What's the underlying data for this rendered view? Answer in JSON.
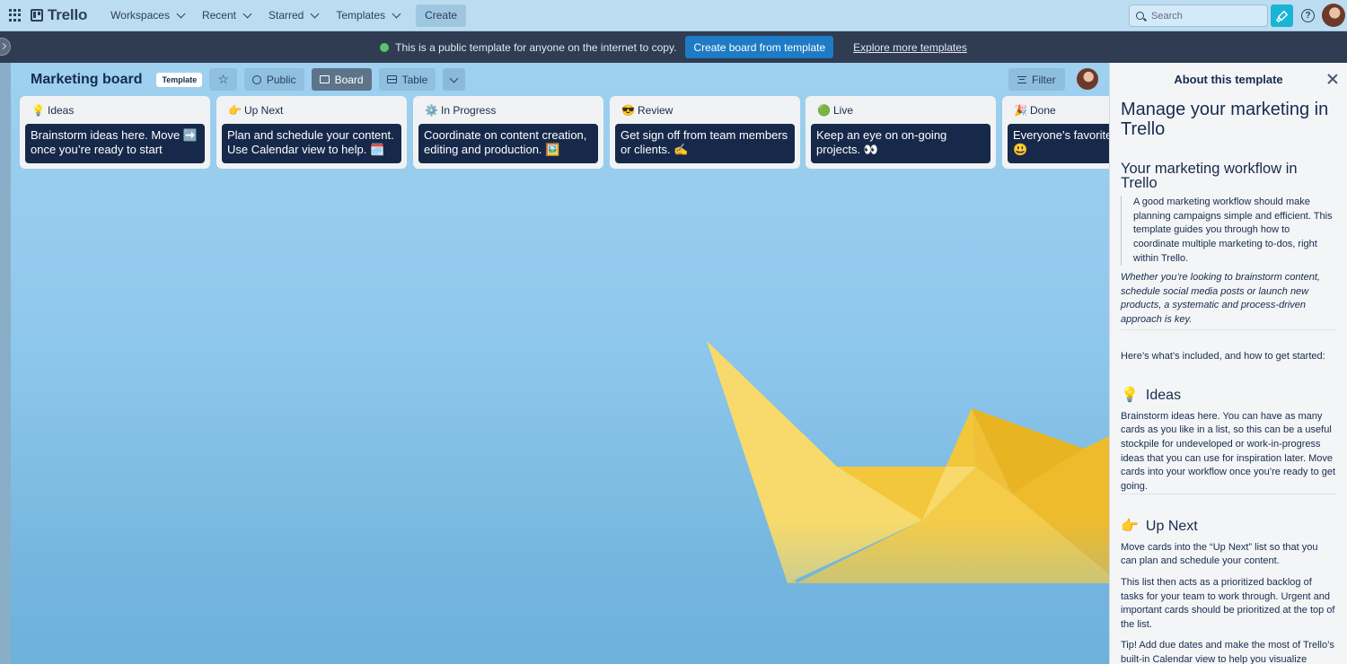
{
  "nav": {
    "logo": "Trello",
    "items": [
      "Workspaces",
      "Recent",
      "Starred",
      "Templates"
    ],
    "create": "Create",
    "search_placeholder": "Search"
  },
  "banner": {
    "text": "This is a public template for anyone on the internet to copy.",
    "cta": "Create board from template",
    "link": "Explore more templates"
  },
  "board": {
    "title": "Marketing board",
    "badge": "Template",
    "visibility": "Public",
    "views": [
      "Board",
      "Table"
    ],
    "filter": "Filter"
  },
  "lists": [
    {
      "title": "Ideas",
      "emoji": "💡",
      "card": "Brainstorm ideas here. Move ➡️ once you’re ready to start"
    },
    {
      "title": "Up Next",
      "emoji": "👉",
      "card": "Plan and schedule your content. Use Calendar view to help. 🗓️"
    },
    {
      "title": "In Progress",
      "emoji": "⚙️",
      "card": "Coordinate on content creation, editing and production. 🖼️"
    },
    {
      "title": "Review",
      "emoji": "😎",
      "card": "Get sign off from team members or clients. ✍️"
    },
    {
      "title": "Live",
      "emoji": "🟢",
      "card": "Keep an eye on on-going projects. 👀"
    },
    {
      "title": "Done",
      "emoji": "🎉",
      "card": "Everyone’s favorite 😃"
    }
  ],
  "panel": {
    "header": "About this template",
    "title": "Manage your marketing in Trello",
    "subtitle": "Your marketing workflow in Trello",
    "quote": "A good marketing workflow should make planning campaigns simple and efficient. This template guides you through how to coordinate multiple marketing to-dos, right within Trello.",
    "italic": "Whether you’re looking to brainstorm content, schedule social media posts or launch new products, a systematic and process-driven approach is key.",
    "intro": "Here’s what’s included, and how to get started:",
    "ideas_heading": "Ideas",
    "ideas_emoji": "💡",
    "ideas_text": "Brainstorm ideas here. You can have as many cards as you like in a list, so this can be a useful stockpile for undeveloped or work-in-progress ideas that you can use for inspiration later. Move cards into your workflow once you’re ready to get going.",
    "upnext_heading": "Up Next",
    "upnext_emoji": "👉",
    "upnext_text1": "Move cards into the “Up Next” list so that you can plan and schedule your content.",
    "upnext_text2": "This list then acts as a prioritized backlog of tasks for your team to work through. Urgent and important cards should be prioritized at the top of the list.",
    "upnext_text3": "Tip! Add due dates and make the most of Trello’s built-in Calendar view to help you visualize"
  },
  "colors": {
    "topnav": "#bcdcf1",
    "banner": "#2f3c52",
    "cta": "#1e7bc5",
    "card": "#16294a",
    "notify": "#1ab5d4"
  }
}
